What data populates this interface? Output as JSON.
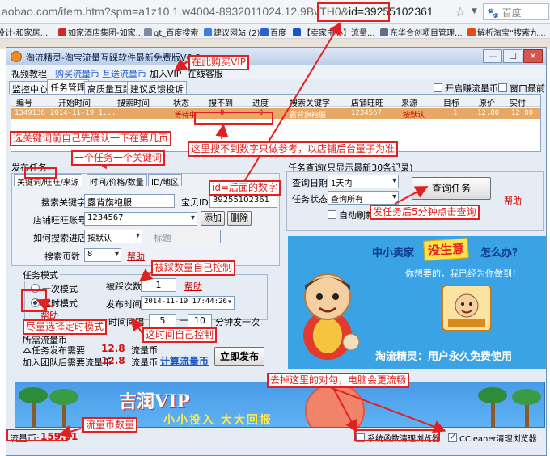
{
  "browser": {
    "url_prefix": "aobao.com/item.htm?spm=a1z10.1.w4004-8932011024.12.9BvTH0&",
    "url_id": "id=39255102361",
    "search_placeholder": "百度",
    "bookmarks": [
      "设计-和家居...",
      "如家酒店集团-如家...",
      "qt_百度搜索",
      "建议网站 (2)",
      "百度",
      "【卖家中心】流量...",
      "东华合创项目管理...",
      "解析淘宝“搜索九..."
    ]
  },
  "app": {
    "title": "淘流精灵-淘宝流量互踩软件最新免费版V6.8",
    "window_buttons": [
      "—",
      "☐",
      "✕"
    ],
    "menu": [
      {
        "label": "视频教程",
        "blue": false
      },
      {
        "label": "购买流量币",
        "blue": true
      },
      {
        "label": "互送流量币",
        "blue": true
      },
      {
        "label": "加入VIP",
        "blue": false
      },
      {
        "label": "在线客服",
        "blue": false
      }
    ],
    "tabs": [
      "监控中心",
      "任务管理",
      "高质量互踩",
      "建议反馈投诉"
    ],
    "top_checks": [
      "开启赚流量币",
      "窗口最前"
    ]
  },
  "task_table": {
    "headers": [
      "编号",
      "开始时间",
      "搜索时间",
      "状态",
      "搜不到",
      "进度",
      "搜索关键字",
      "店铺旺旺",
      "来源",
      "目标",
      "原价",
      "实付"
    ],
    "row": [
      "1349138",
      "2014-11-19 1...",
      "",
      "等待中",
      "0",
      "0",
      "露背旗袍服",
      "1234567",
      "按默认",
      "1",
      "12.80",
      "12.80"
    ]
  },
  "publish": {
    "title": "发布任务",
    "tabs": [
      "关键词/旺旺/来源",
      "时间/价格/数量",
      "ID/地区"
    ],
    "keyword_label": "搜索关键字",
    "keyword_value": "露背旗袍服",
    "babyid_label": "宝贝ID",
    "babyid_value": "39255102361",
    "shop_label": "店铺旺旺账号",
    "shop_value": "1234567",
    "add_button": "添加",
    "delete_button": "删除",
    "enter_label": "如何搜索进店",
    "enter_value": "按默认",
    "tag_label": "标题",
    "tag_placeholder": "",
    "pages_label": "搜索页数",
    "pages_value": "8",
    "help": "帮助"
  },
  "task_mode": {
    "title": "任务模式",
    "mode_once": "一次模式",
    "mode_timed": "定时模式",
    "help": "帮助",
    "clicks_label": "被踩次数",
    "clicks_value": "1",
    "time_label": "发布时间",
    "time_date": "2014-11-19",
    "time_clock": "17:44:26",
    "interval_label": "时间间隔",
    "interval_from": "5",
    "interval_to": "10",
    "interval_unit": "分钟发一次"
  },
  "cost": {
    "title": "所需流量币",
    "row1_label": "本任务发布需要",
    "row1_value": "12.8",
    "row1_unit": "流量币",
    "row2_label": "加入团队后需要流量币",
    "row2_value": "12.8",
    "row2_unit": "流量币",
    "calc_link": "计算流量币",
    "publish_button": "立即发布"
  },
  "query": {
    "title": "任务查询(只显示最新30条记录)",
    "date_label": "查询日期",
    "date_value": "1天内",
    "status_label": "任务状态",
    "status_value": "查询所有",
    "auto_refresh": "自动刷新",
    "button": "查询任务",
    "help": "帮助"
  },
  "ad": {
    "title_left": "中小卖家",
    "badge": "没生意",
    "title_right": "怎么办？",
    "sub": "你想要的，我已经为你做到！",
    "footer": "淘流精灵：用户永久免费使用"
  },
  "banner": {
    "logo": "吉润VIP",
    "slogan": "小小投入 大大回报"
  },
  "status": {
    "coins_label": "流量币:",
    "coins_value": "159.31",
    "check1": "系统函数清理浏览器",
    "check2": "CCleaner清理浏览器"
  },
  "annotations": {
    "vip": "在此购买VIP",
    "check_page": "选关键词前自己先确认一下在第几页",
    "one_task": "一个任务一个关键词",
    "id_note": "id=后面的数字",
    "cannot_find": "这里搜不到数字只做参考，以店铺后台量子为准",
    "query_tip": "发任务后5分钟点击查询",
    "clicks_tip": "被踩数量自己控制",
    "timed_tip": "尽量选择定时模式",
    "interval_tip": "这时间自己控制",
    "cleanup_tip": "去掉这里的对勾，电脑会更流畅",
    "coins_tip": "流量币数量"
  },
  "colors": {
    "accent_red": "#e0211f",
    "row_highlight": "#e8a865",
    "link_blue": "#1b56c8",
    "ad_blue": "#3aa3e6"
  }
}
